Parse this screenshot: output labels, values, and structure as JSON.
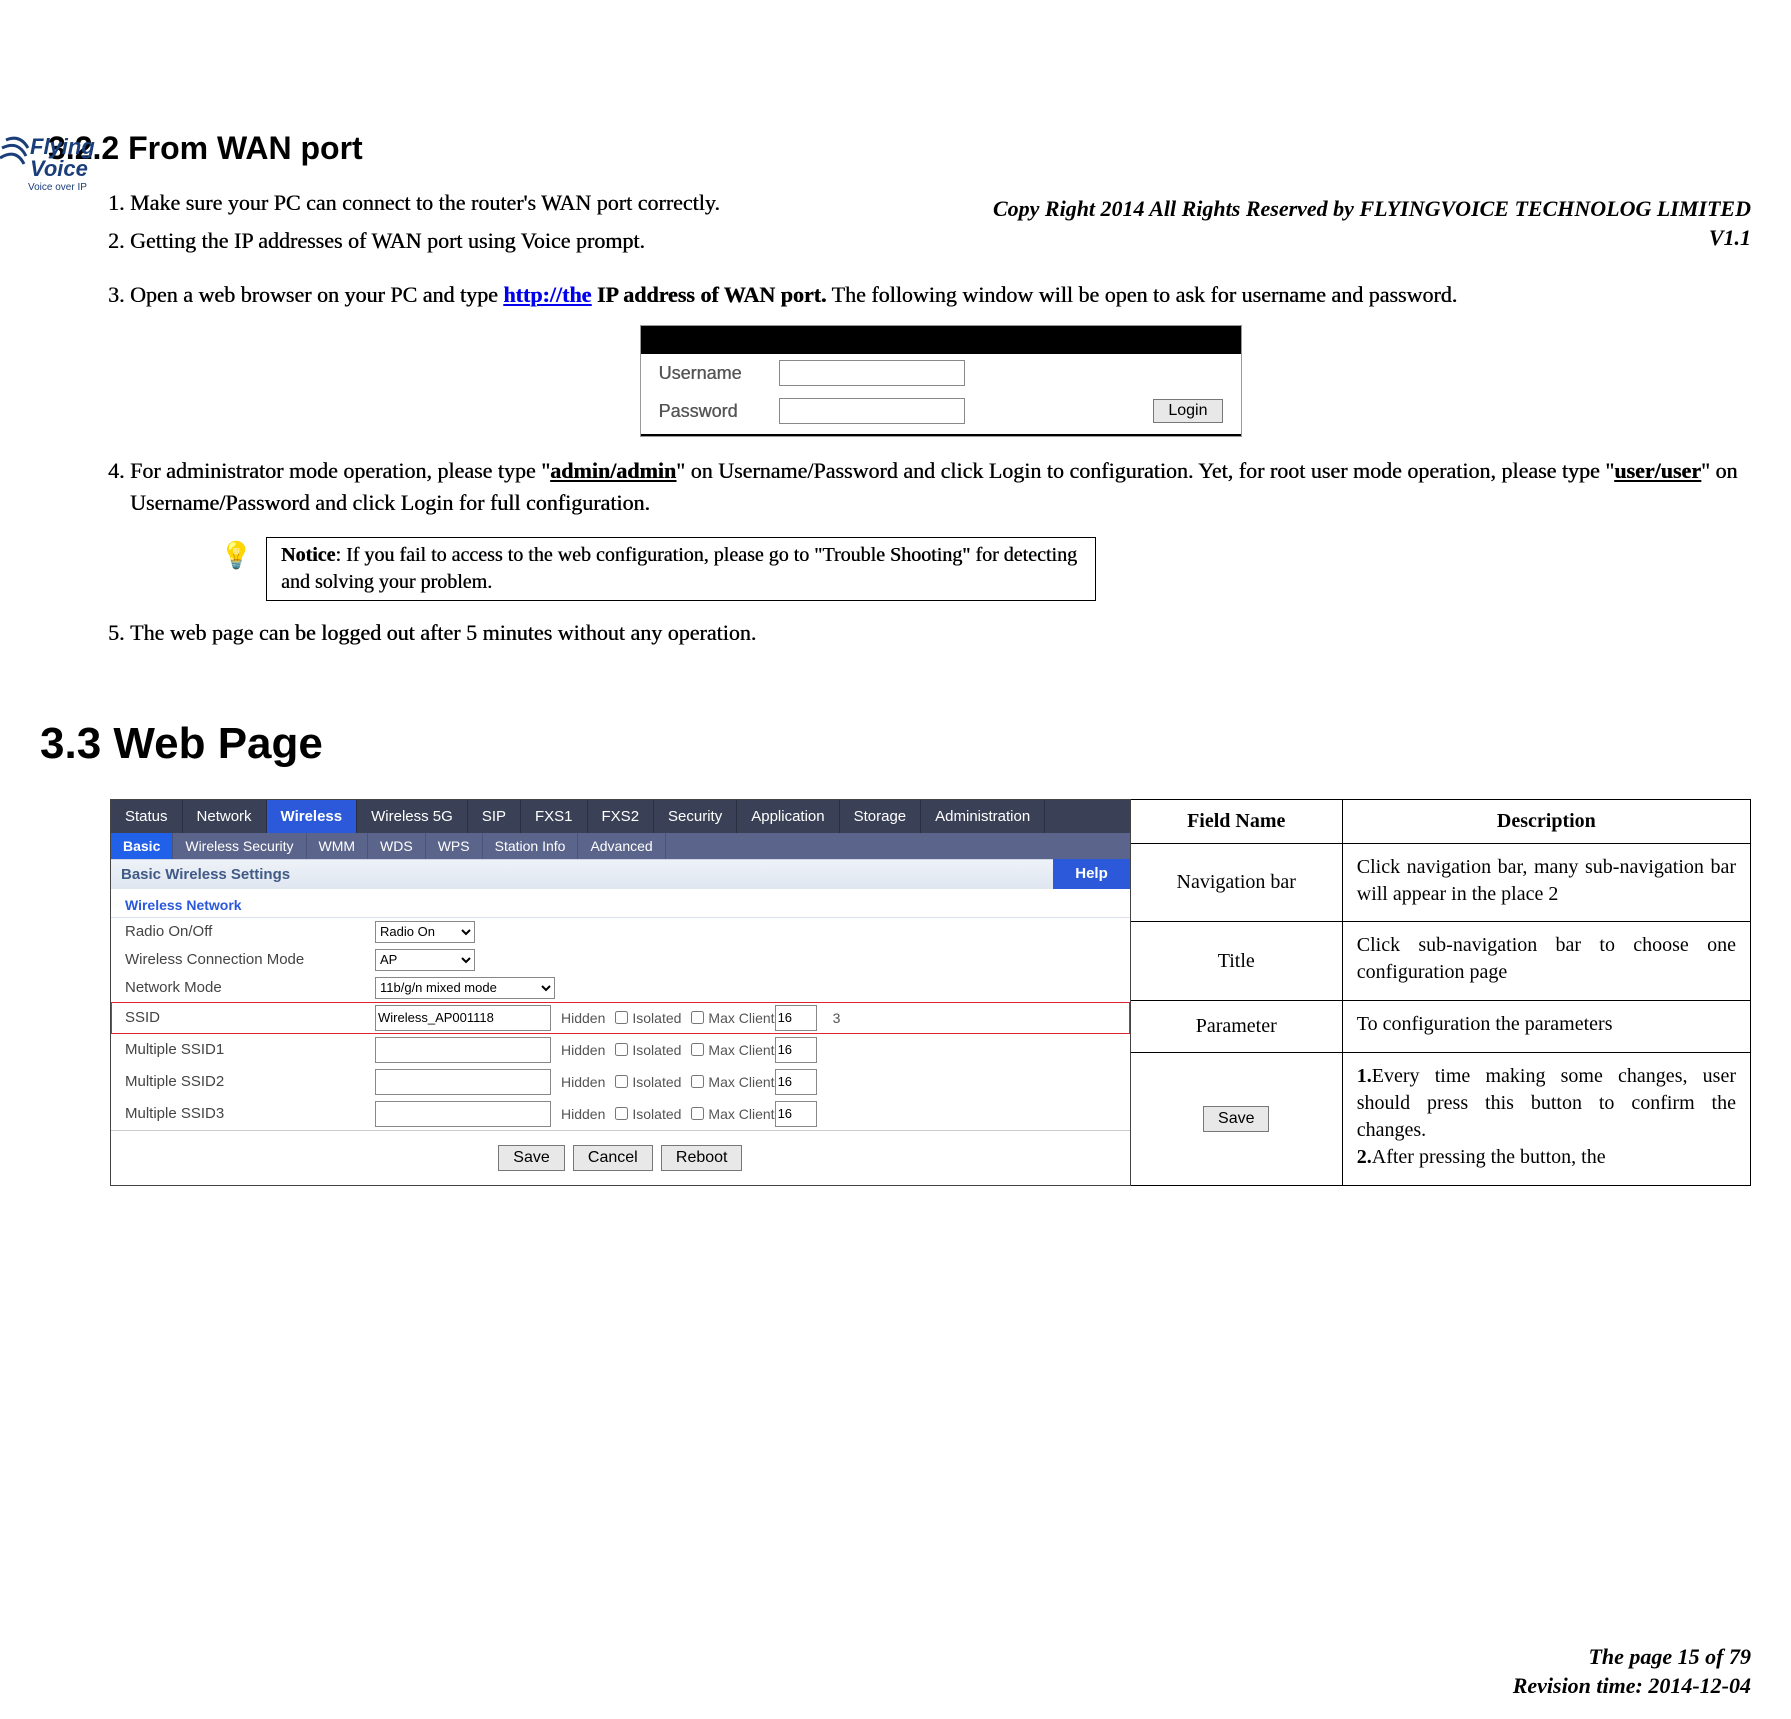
{
  "header": {
    "copyright": "Copy Right 2014 All Rights Reserved by FLYINGVOICE TECHNOLOG LIMITED",
    "version": "V1.1",
    "logo": {
      "top": "Flying",
      "mid": "Voice",
      "bottom": "Voice over IP"
    }
  },
  "section_322": {
    "title": "3.2.2 From WAN port",
    "steps_a": {
      "s1": "Make sure your PC can connect to the router's WAN port correctly.",
      "s2": "Getting the IP addresses of WAN port using Voice prompt."
    },
    "step3_pre": "Open a web browser on your PC and type ",
    "step3_link": "http://the",
    "step3_bold": " IP address of WAN port.",
    "step3_post": " The following window will be open to ask for username and password.",
    "login": {
      "username_label": "Username",
      "password_label": "Password",
      "login_btn": "Login"
    },
    "step4_pre": "For administrator mode operation, please type \"",
    "step4_b1": "admin/admin",
    "step4_mid": "\" on Username/Password and click Login to configuration. Yet, for root user mode operation, please type \"",
    "step4_b2": "user/user",
    "step4_post": "\" on Username/Password and click Login for full configuration.",
    "notice_label": "Notice",
    "notice_text": ": If you fail to access to the web configuration, please go to \"Trouble Shooting\" for detecting and solving your problem.",
    "step5": "The web page can be logged out after 5 minutes without any operation."
  },
  "section_33": {
    "title": "3.3   Web Page"
  },
  "router": {
    "nav1": [
      "Status",
      "Network",
      "Wireless",
      "Wireless 5G",
      "SIP",
      "FXS1",
      "FXS2",
      "Security",
      "Application",
      "Storage",
      "Administration"
    ],
    "nav1_selected": 2,
    "nav2": [
      "Basic",
      "Wireless Security",
      "WMM",
      "WDS",
      "WPS",
      "Station Info",
      "Advanced"
    ],
    "nav2_selected": 0,
    "panel_title": "Basic Wireless Settings",
    "help_label": "Help",
    "section_head": "Wireless Network",
    "rows": {
      "radio": {
        "label": "Radio On/Off",
        "value": "Radio On"
      },
      "conn": {
        "label": "Wireless Connection Mode",
        "value": "AP"
      },
      "netmode": {
        "label": "Network Mode",
        "value": "11b/g/n mixed mode"
      },
      "ssid": {
        "label": "SSID",
        "value": "Wireless_AP001118",
        "hidden": "Hidden",
        "isolated": "Isolated",
        "maxclient_label": "Max Client",
        "maxclient": "16",
        "extra": "3"
      },
      "m1": {
        "label": "Multiple SSID1",
        "maxclient": "16"
      },
      "m2": {
        "label": "Multiple SSID2",
        "maxclient": "16"
      },
      "m3": {
        "label": "Multiple SSID3",
        "maxclient": "16"
      }
    },
    "buttons": {
      "save": "Save",
      "cancel": "Cancel",
      "reboot": "Reboot"
    }
  },
  "desc_table": {
    "head": {
      "c1": "Field Name",
      "c2": "Description"
    },
    "r1": {
      "c1": "Navigation bar",
      "c2": "Click navigation bar, many sub-navigation bar will appear in the place 2"
    },
    "r2": {
      "c1": "Title",
      "c2": "Click sub-navigation bar to choose one configuration page"
    },
    "r3": {
      "c1": "Parameter",
      "c2": "To configuration the parameters"
    },
    "r4": {
      "btn": "Save",
      "d1_b": "1.",
      "d1": "Every time making some changes, user should press this button to confirm the changes.",
      "d2_b": "2.",
      "d2": "After pressing the button, the"
    }
  },
  "footer": {
    "page": "The page 15 of 79",
    "rev": "Revision time: 2014-12-04"
  }
}
